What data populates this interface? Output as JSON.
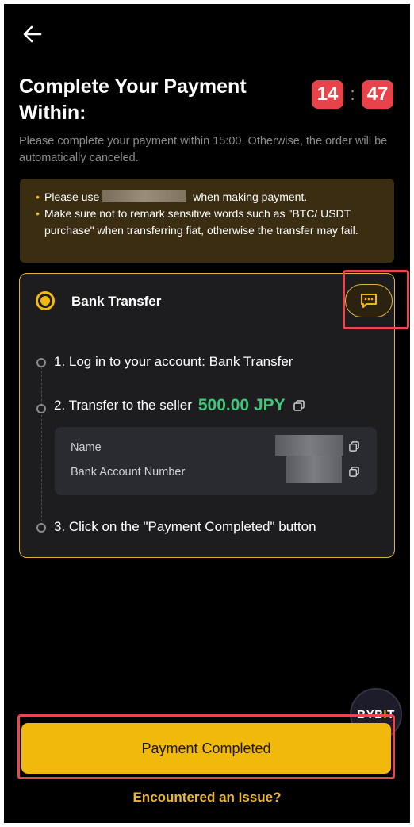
{
  "header": {
    "title": "Complete Your Payment Within:",
    "timer": {
      "minutes": "14",
      "separator": ":",
      "seconds": "47"
    },
    "note": "Please complete your payment within 15:00. Otherwise, the order will be automatically canceled."
  },
  "tips": {
    "tip1_prefix": "Please use",
    "tip1_suffix": "when making payment.",
    "tip2": "Make sure not to remark sensitive words such as \"BTC/ USDT purchase\" when transferring fiat, otherwise the transfer may fail."
  },
  "payment_card": {
    "method": "Bank Transfer",
    "step1": "1. Log in to your account:  Bank Transfer",
    "step2_label": "2. Transfer to the seller",
    "amount": "500.00 JPY",
    "detail_name_label": "Name",
    "detail_account_label": "Bank Account Number",
    "step3": "3. Click on the \"Payment Completed\" button"
  },
  "actions": {
    "payment_completed": "Payment Completed",
    "issue_link": "Encountered an Issue?"
  },
  "brand": {
    "logo_text_pre": "BYB",
    "logo_text_i": "I",
    "logo_text_post": "T"
  },
  "colors": {
    "accent": "#f0b90b",
    "timer_bg": "#e8434b",
    "amount": "#3ec97a",
    "highlight": "#e5484d"
  },
  "icons": {
    "back": "arrow-left-icon",
    "chat": "chat-bubble-icon",
    "copy": "copy-icon"
  }
}
